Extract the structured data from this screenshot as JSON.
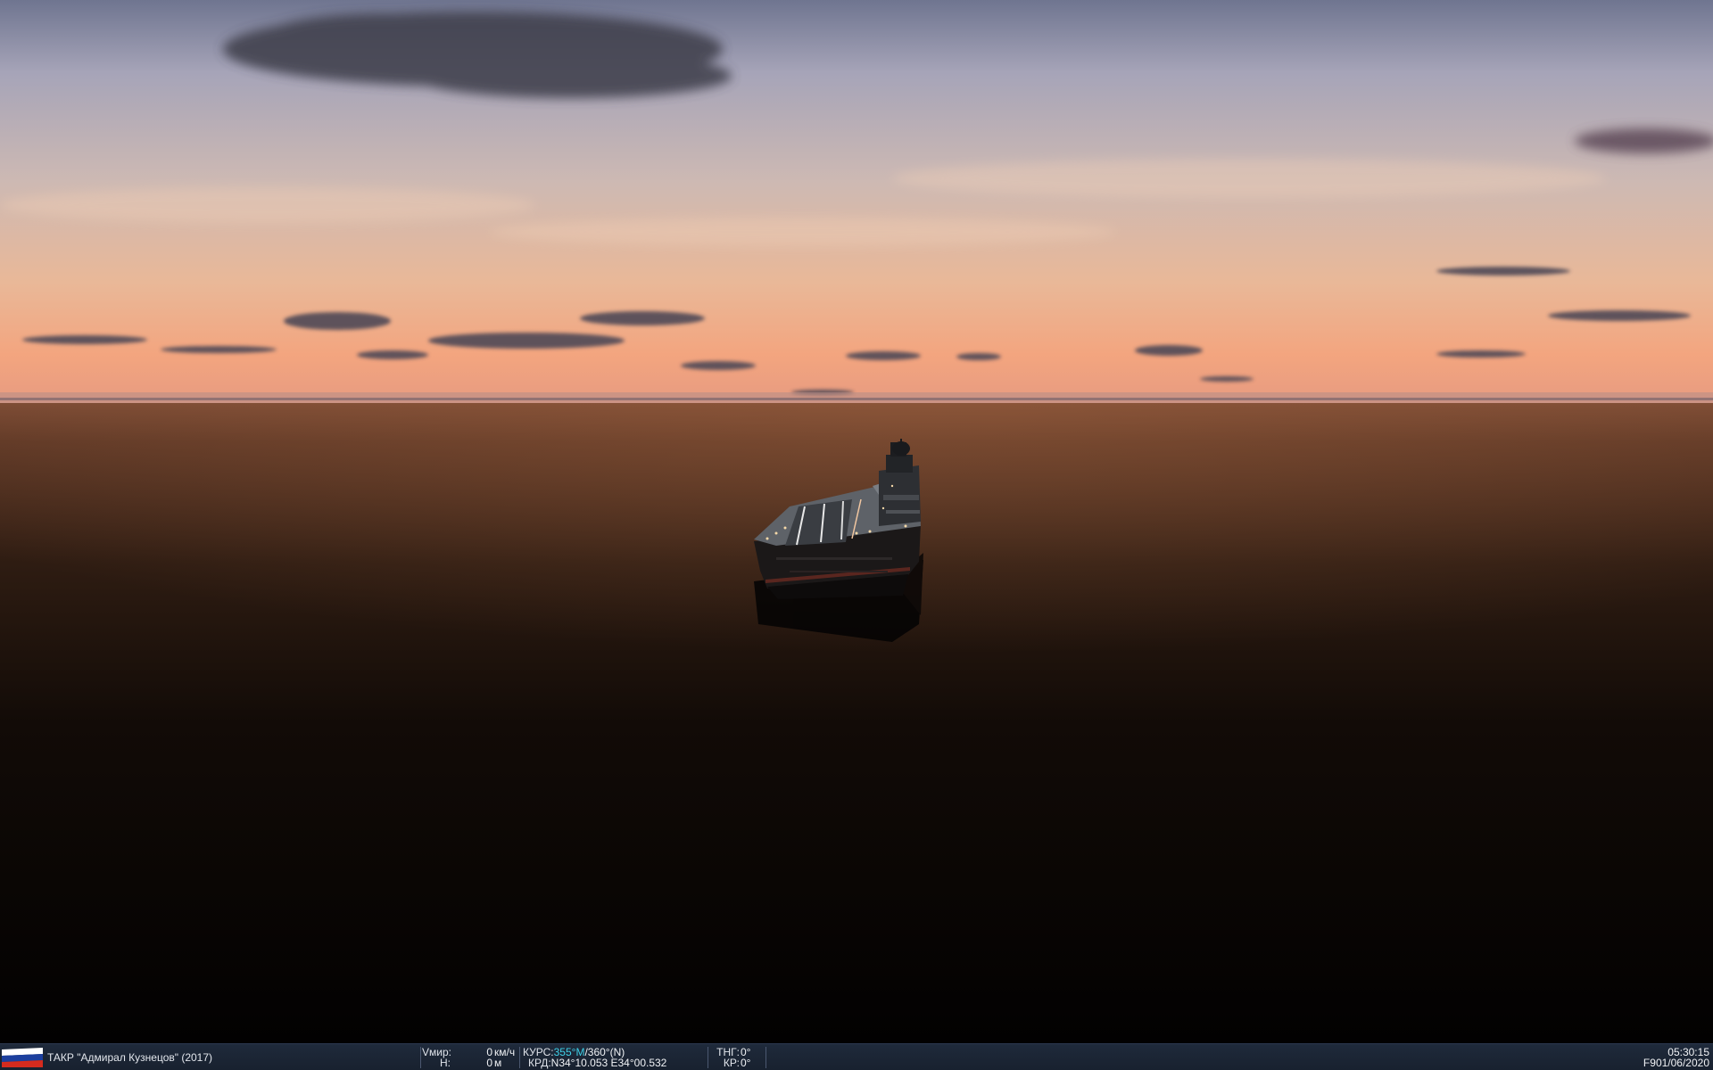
{
  "unit": {
    "name": "ТАКР \"Адмирал Кузнецов\" (2017)",
    "flag_colors": [
      "#ffffff",
      "#1c3f9e",
      "#d52b1e"
    ]
  },
  "readouts": {
    "speed_label": "Vмир:",
    "speed_value": "0",
    "speed_unit": "км/ч",
    "alt_label": "Н:",
    "alt_value": "0",
    "alt_unit": "м",
    "course_label": "КУРС:",
    "course_magnetic": "355°М",
    "course_true": "/360°(N)",
    "coord_label": "КРД:",
    "coord_value": "N34°10.053 E34°00.532",
    "pitch_label": "ТНГ:",
    "pitch_value": "0°",
    "roll_label": "КР:",
    "roll_value": "0°"
  },
  "clock": {
    "time": "05:30:15",
    "key": "F9",
    "date": "01/06/2020"
  },
  "colors": {
    "status_bar": "#1c2636",
    "highlight": "#3fd0e8",
    "sky_top": "#7b7f98",
    "horizon": "#f2a37e",
    "sea_dark": "#050302"
  }
}
